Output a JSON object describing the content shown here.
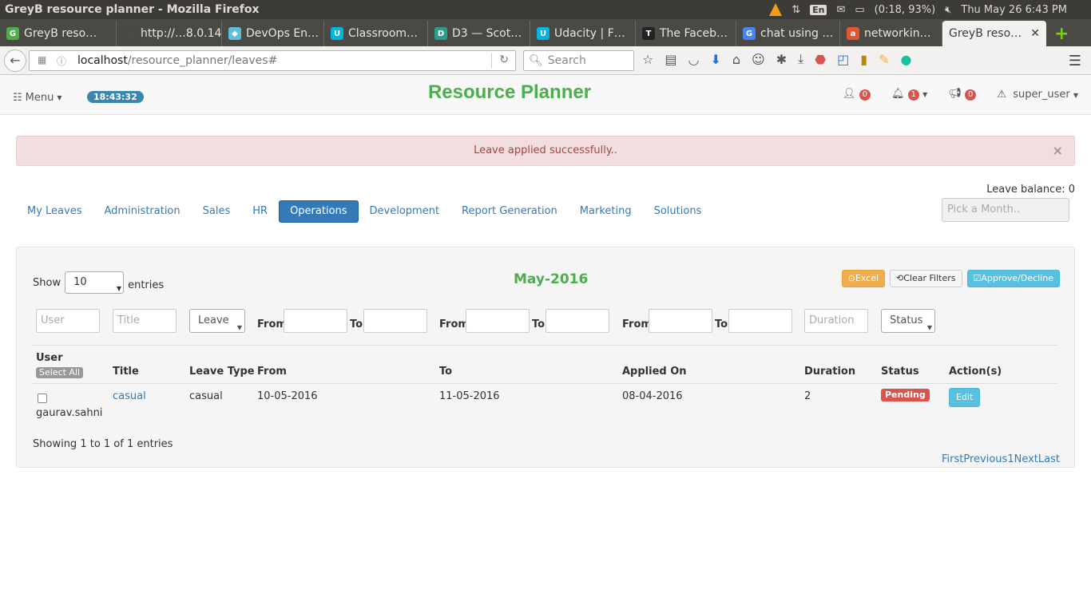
{
  "os": {
    "window_title": "GreyB resource planner - Mozilla Firefox",
    "keyboard": "En",
    "battery": "(0:18, 93%)",
    "datetime": "Thu May 26  6:43 PM"
  },
  "browser": {
    "tabs": [
      {
        "label": "GreyB reso…",
        "fav": "G",
        "color": "#4cae4c"
      },
      {
        "label": "http://…8.0.14/",
        "fav": "",
        "color": "#4a4944"
      },
      {
        "label": "DevOps En…",
        "fav": "◆",
        "color": "#5bc0de"
      },
      {
        "label": "Classroom…",
        "fav": "U",
        "color": "#02b3e4"
      },
      {
        "label": "D3 — Scot…",
        "fav": "D",
        "color": "#2a9d8f"
      },
      {
        "label": "Udacity | F…",
        "fav": "U",
        "color": "#02b3e4"
      },
      {
        "label": "The Faceb…",
        "fav": "T",
        "color": "#222"
      },
      {
        "label": "chat using …",
        "fav": "G",
        "color": "#4285f4"
      },
      {
        "label": "networkin…",
        "fav": "a",
        "color": "#e4572e"
      }
    ],
    "active_tab": "GreyB reso…",
    "url_host": "localhost",
    "url_path": "/resource_planner/leaves#",
    "search_placeholder": "Search"
  },
  "header": {
    "menu_label": "Menu",
    "clock": "18:43:32",
    "brand": "Resource Planner",
    "user_count": "0",
    "notif_count": "1",
    "announce_count": "0",
    "username": "super_user"
  },
  "alert": {
    "message": "Leave applied successfully..",
    "close": "×"
  },
  "leave_balance": "Leave balance: 0",
  "tabs": [
    "My Leaves",
    "Administration",
    "Sales",
    "HR",
    "Operations",
    "Development",
    "Report Generation",
    "Marketing",
    "Solutions"
  ],
  "active_tab": "Operations",
  "month_picker_placeholder": "Pick a Month..",
  "panel": {
    "show_label": "Show",
    "entries_value": "10",
    "entries_label": "entries",
    "month_title": "May-2016",
    "excel": "Excel",
    "clear_filters": "Clear Filters",
    "approve_decline": "Approve/Decline",
    "filters": {
      "user": "User",
      "title": "Title",
      "leave": "Leave",
      "from": "From",
      "to": "To",
      "duration": "Duration",
      "status": "Status"
    },
    "columns": [
      "User",
      "Title",
      "Leave Type",
      "From",
      "To",
      "Applied On",
      "Duration",
      "Status",
      "Action(s)"
    ],
    "select_all": "Select All",
    "rows": [
      {
        "user": "gaurav.sahni",
        "title": "casual",
        "leave_type": "casual",
        "from": "10-05-2016",
        "to": "11-05-2016",
        "applied_on": "08-04-2016",
        "duration": "2",
        "status": "Pending",
        "action": "Edit"
      }
    ],
    "showing": "Showing 1 to 1 of 1 entries",
    "pager": [
      "First",
      "Previous",
      "1",
      "Next",
      "Last"
    ]
  }
}
